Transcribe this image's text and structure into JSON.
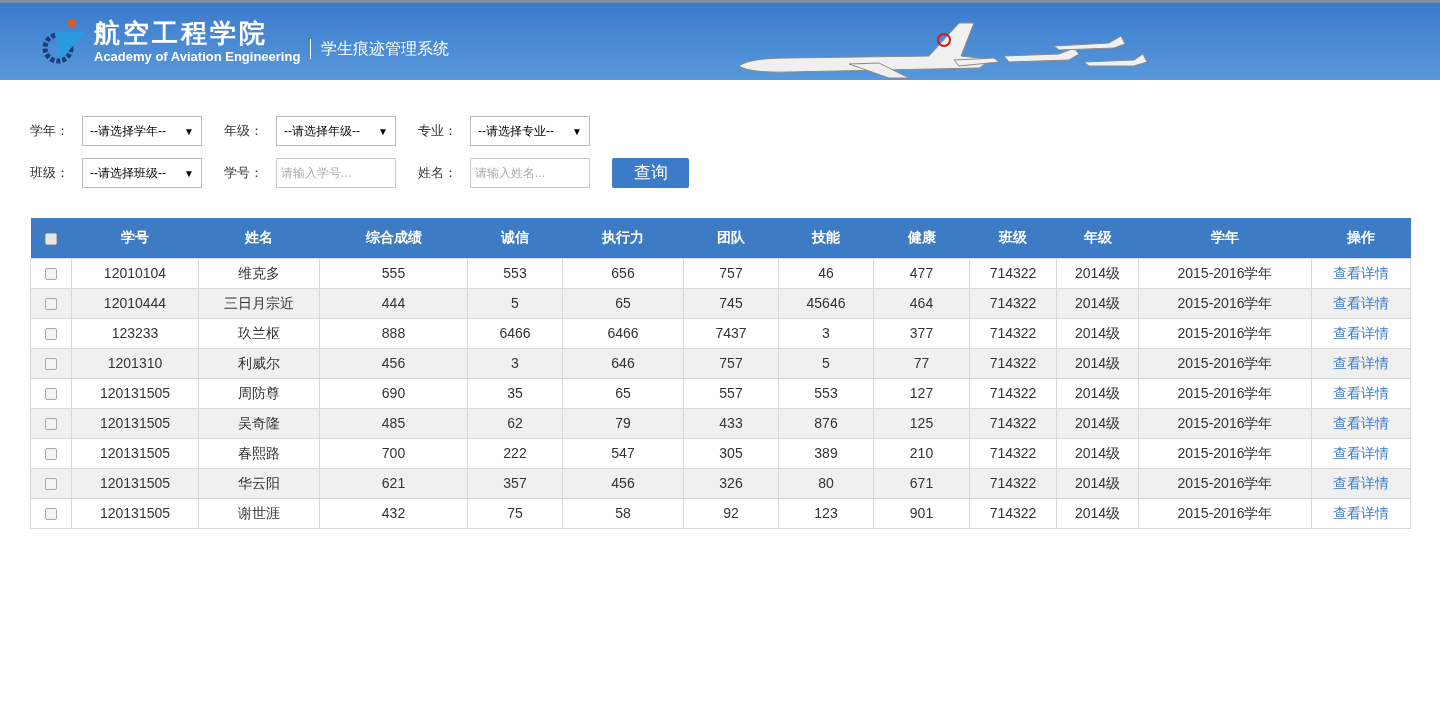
{
  "header": {
    "title": "航空工程学院",
    "subtitle": "Academy of Aviation Engineering",
    "system_name": "学生痕迹管理系统"
  },
  "filters": [
    {
      "kind": "select",
      "label": "学年：",
      "value": "--请选择学年--",
      "arrow": "▼"
    },
    {
      "kind": "select",
      "label": "年级：",
      "value": "--请选择年级--",
      "arrow": "▼"
    },
    {
      "kind": "select",
      "label": "专业：",
      "value": "--请选择专业--",
      "arrow": "▼"
    },
    {
      "kind": "select",
      "label": "班级：",
      "value": "--请选择班级--",
      "arrow": "▼"
    },
    {
      "kind": "input",
      "label": "学号：",
      "placeholder": "请输入学号..."
    },
    {
      "kind": "input",
      "label": "姓名：",
      "placeholder": "请输入姓名..."
    }
  ],
  "search_button": "查询",
  "table": {
    "select_all": {
      "checked": false
    },
    "columns": [
      "学号",
      "姓名",
      "综合成绩",
      "诚信",
      "执行力",
      "团队",
      "技能",
      "健康",
      "班级",
      "年级",
      "学年",
      "操作"
    ],
    "rows": [
      {
        "checked": false,
        "cells": [
          "12010104",
          "维克多",
          "555",
          "553",
          "656",
          "757",
          "46",
          "477",
          "714322",
          "2014级",
          "2015-2016学年"
        ],
        "action": "查看详情"
      },
      {
        "checked": false,
        "cells": [
          "12010444",
          "三日月宗近",
          "444",
          "5",
          "65",
          "745",
          "45646",
          "464",
          "714322",
          "2014级",
          "2015-2016学年"
        ],
        "action": "查看详情"
      },
      {
        "checked": false,
        "cells": [
          "123233",
          "玖兰枢",
          "888",
          "6466",
          "6466",
          "7437",
          "3",
          "377",
          "714322",
          "2014级",
          "2015-2016学年"
        ],
        "action": "查看详情"
      },
      {
        "checked": false,
        "cells": [
          "1201310",
          "利威尔",
          "456",
          "3",
          "646",
          "757",
          "5",
          "77",
          "714322",
          "2014级",
          "2015-2016学年"
        ],
        "action": "查看详情"
      },
      {
        "checked": false,
        "cells": [
          "120131505",
          "周防尊",
          "690",
          "35",
          "65",
          "557",
          "553",
          "127",
          "714322",
          "2014级",
          "2015-2016学年"
        ],
        "action": "查看详情"
      },
      {
        "checked": false,
        "cells": [
          "120131505",
          "吴奇隆",
          "485",
          "62",
          "79",
          "433",
          "876",
          "125",
          "714322",
          "2014级",
          "2015-2016学年"
        ],
        "action": "查看详情"
      },
      {
        "checked": false,
        "cells": [
          "120131505",
          "春熙路",
          "700",
          "222",
          "547",
          "305",
          "389",
          "210",
          "714322",
          "2014级",
          "2015-2016学年"
        ],
        "action": "查看详情"
      },
      {
        "checked": false,
        "cells": [
          "120131505",
          "华云阳",
          "621",
          "357",
          "456",
          "326",
          "80",
          "671",
          "714322",
          "2014级",
          "2015-2016学年"
        ],
        "action": "查看详情"
      },
      {
        "checked": false,
        "cells": [
          "120131505",
          "谢世涯",
          "432",
          "75",
          "58",
          "92",
          "123",
          "901",
          "714322",
          "2014级",
          "2015-2016学年"
        ],
        "action": "查看详情"
      }
    ]
  }
}
